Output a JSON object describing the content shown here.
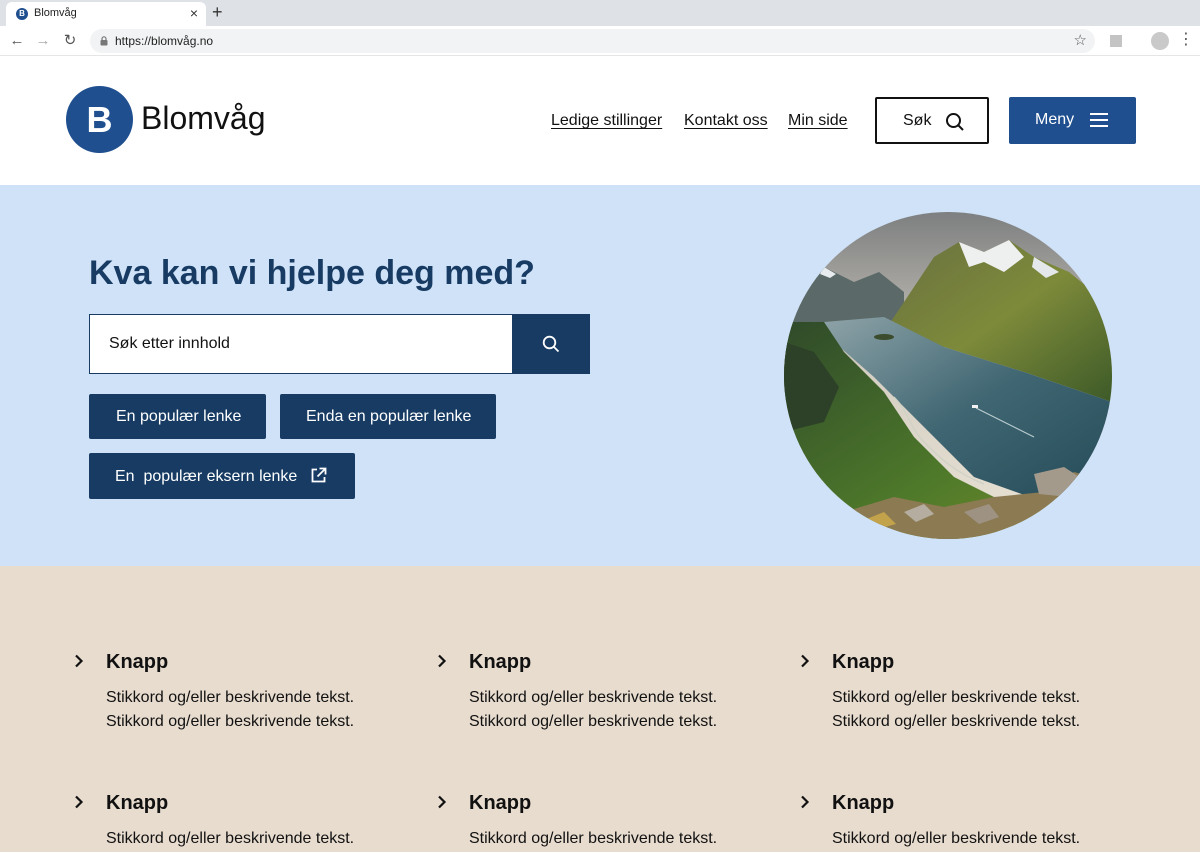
{
  "browser": {
    "tab_title": "Blomvåg",
    "tab_favicon_letter": "B",
    "close_glyph": "×",
    "new_tab_glyph": "+",
    "url": "https://blomvåg.no",
    "back_glyph": "←",
    "forward_glyph": "→",
    "reload_glyph": "↻",
    "star_glyph": "☆",
    "menu_glyph": "⋮"
  },
  "header": {
    "logo_letter": "B",
    "logo_text": "Blomvåg",
    "brand_color": "#1f4f8f",
    "nav": [
      "Ledige stillinger",
      "Kontakt oss",
      "Min side"
    ],
    "search_label": "Søk",
    "menu_label": "Meny"
  },
  "hero": {
    "title": "Kva kan vi hjelpe deg med?",
    "search_placeholder": "Søk etter innhold",
    "links": [
      "En populær lenke",
      "Enda en populær lenke"
    ],
    "external_link": "En  populær eksern lenke",
    "image": "fjord-landscape",
    "accent_color": "#173b63",
    "background_color": "#cfe2f8"
  },
  "cards": {
    "background_color": "#e8dccf",
    "items": [
      {
        "title": "Knapp",
        "lines": [
          "Stikkord og/eller beskrivende tekst.",
          "Stikkord og/eller beskrivende tekst."
        ]
      },
      {
        "title": "Knapp",
        "lines": [
          "Stikkord og/eller beskrivende tekst.",
          "Stikkord og/eller beskrivende tekst."
        ]
      },
      {
        "title": "Knapp",
        "lines": [
          "Stikkord og/eller beskrivende tekst.",
          "Stikkord og/eller beskrivende tekst."
        ]
      },
      {
        "title": "Knapp",
        "lines": [
          "Stikkord og/eller beskrivende tekst."
        ]
      },
      {
        "title": "Knapp",
        "lines": [
          "Stikkord og/eller beskrivende tekst."
        ]
      },
      {
        "title": "Knapp",
        "lines": [
          "Stikkord og/eller beskrivende tekst."
        ]
      }
    ]
  }
}
